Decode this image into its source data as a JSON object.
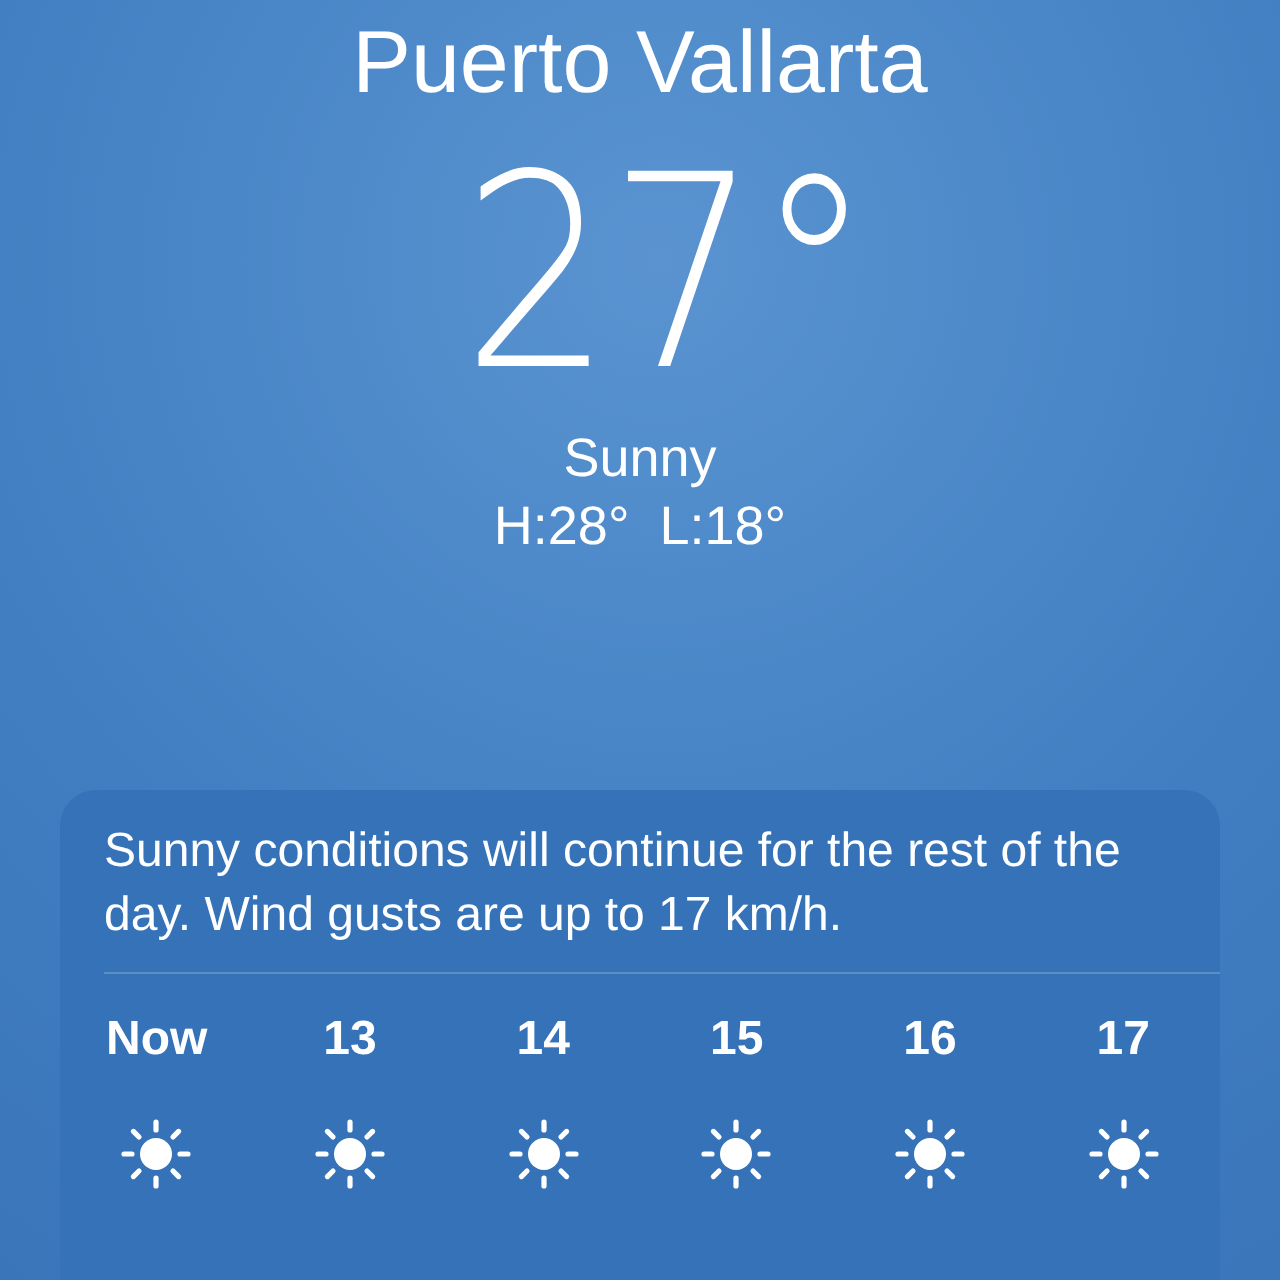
{
  "location": {
    "city": "Puerto Vallarta",
    "temperature": "27°",
    "condition": "Sunny",
    "high_low": "H:28°  L:18°"
  },
  "forecast": {
    "summary": "Sunny conditions will continue for the rest of the day. Wind gusts are up to 17 km/h.",
    "hours": [
      {
        "label": "Now",
        "kind": "sun"
      },
      {
        "label": "13",
        "kind": "sun"
      },
      {
        "label": "14",
        "kind": "sun"
      },
      {
        "label": "15",
        "kind": "sun"
      },
      {
        "label": "16",
        "kind": "sun"
      },
      {
        "label": "17",
        "kind": "sun"
      }
    ]
  }
}
